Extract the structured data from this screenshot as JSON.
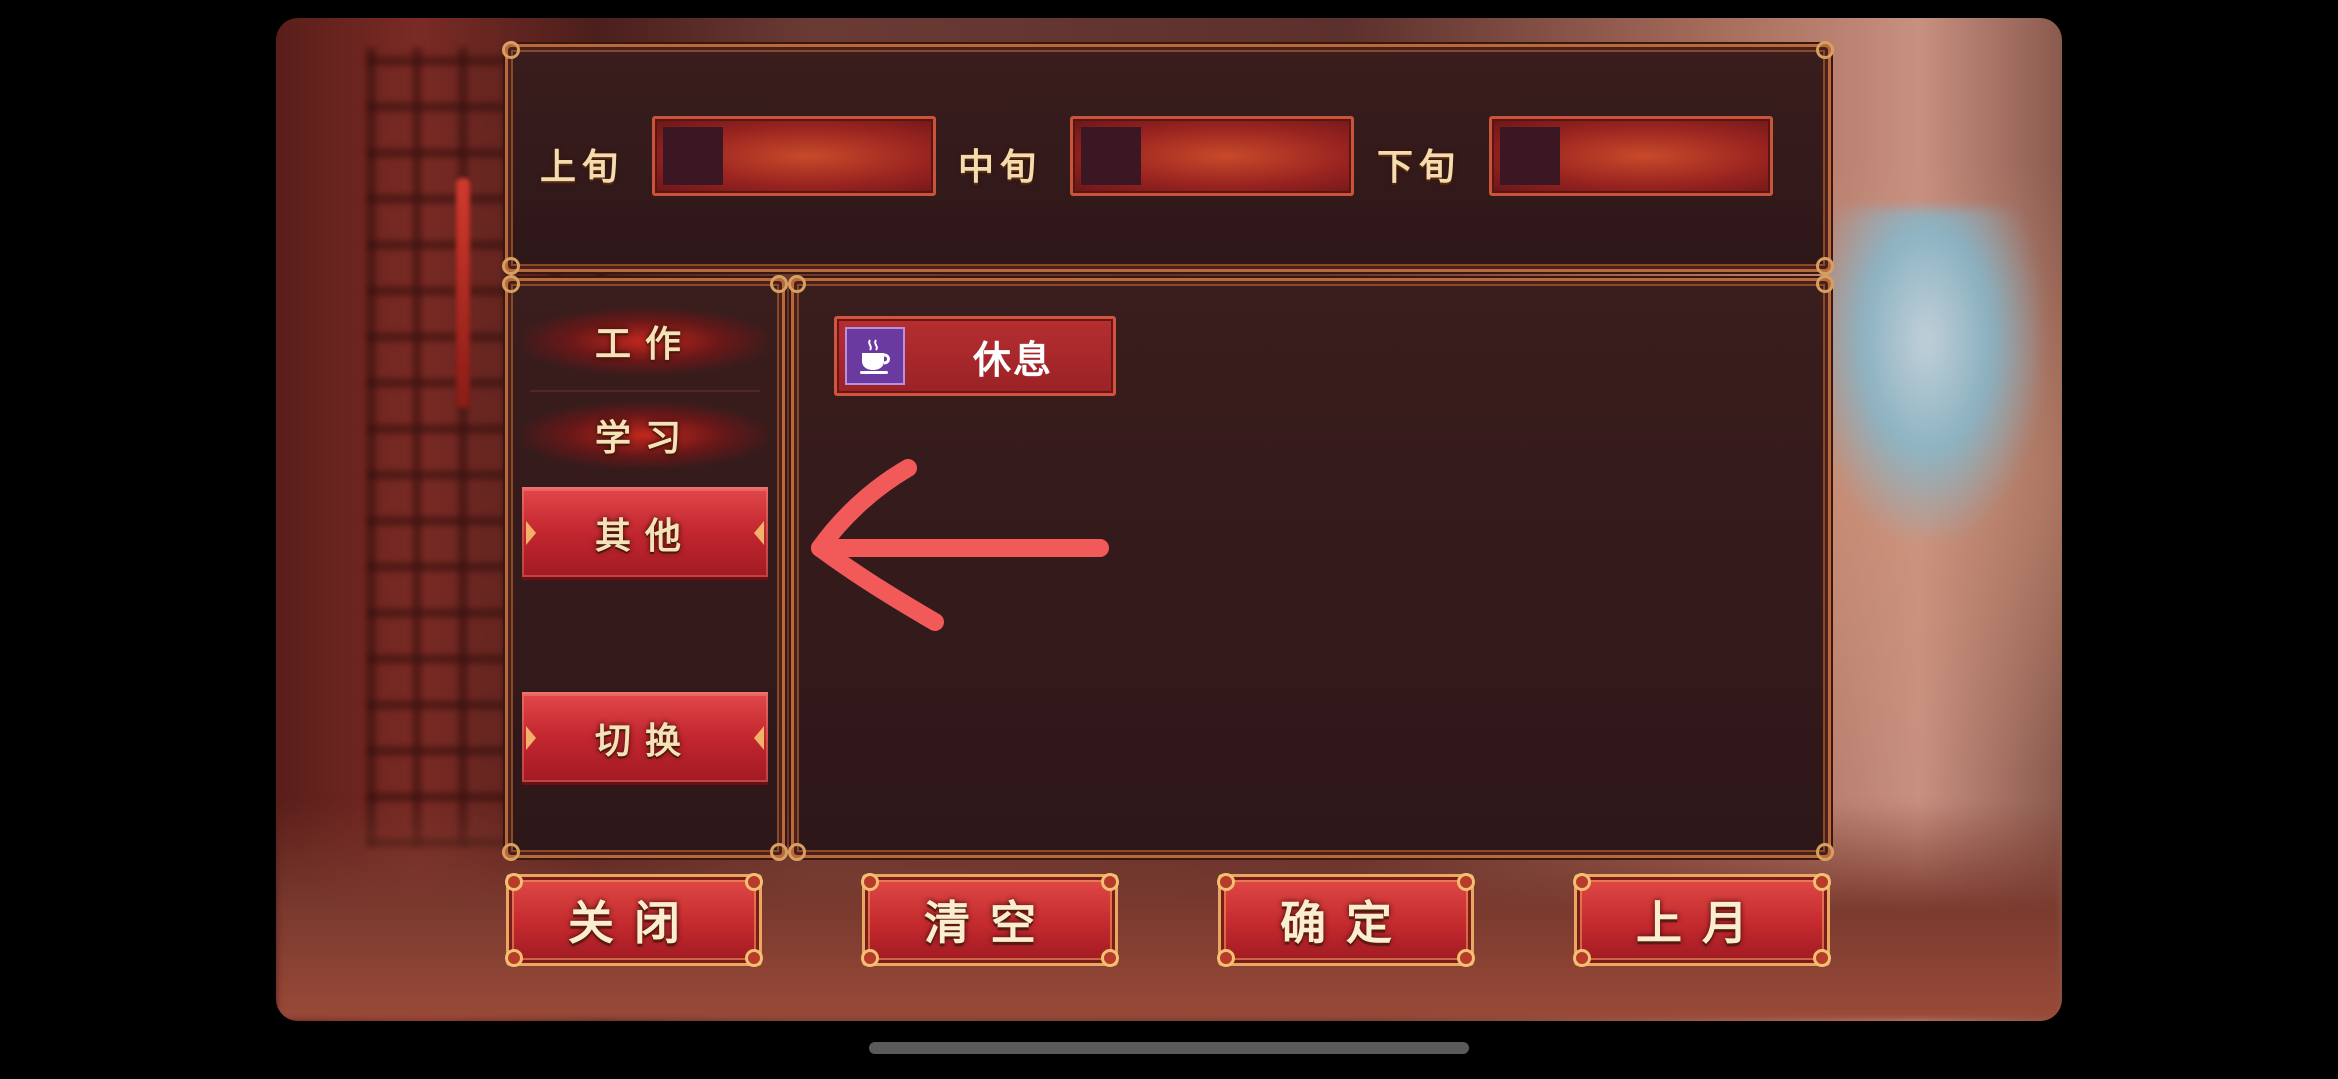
{
  "slots": [
    {
      "label": "上旬"
    },
    {
      "label": "中旬"
    },
    {
      "label": "下旬"
    }
  ],
  "categories": [
    {
      "label": "工作",
      "active": false
    },
    {
      "label": "学习",
      "active": false
    },
    {
      "label": "其他",
      "active": true
    }
  ],
  "switch_label": "切换",
  "actions": [
    {
      "label": "休息",
      "icon": "coffee-cup-icon",
      "icon_color": "#6a3aa0"
    }
  ],
  "bottom_buttons": [
    {
      "label": "关闭"
    },
    {
      "label": "清空"
    },
    {
      "label": "确定"
    },
    {
      "label": "上月"
    }
  ],
  "annotation": {
    "type": "arrow",
    "color": "#f25a5a"
  }
}
